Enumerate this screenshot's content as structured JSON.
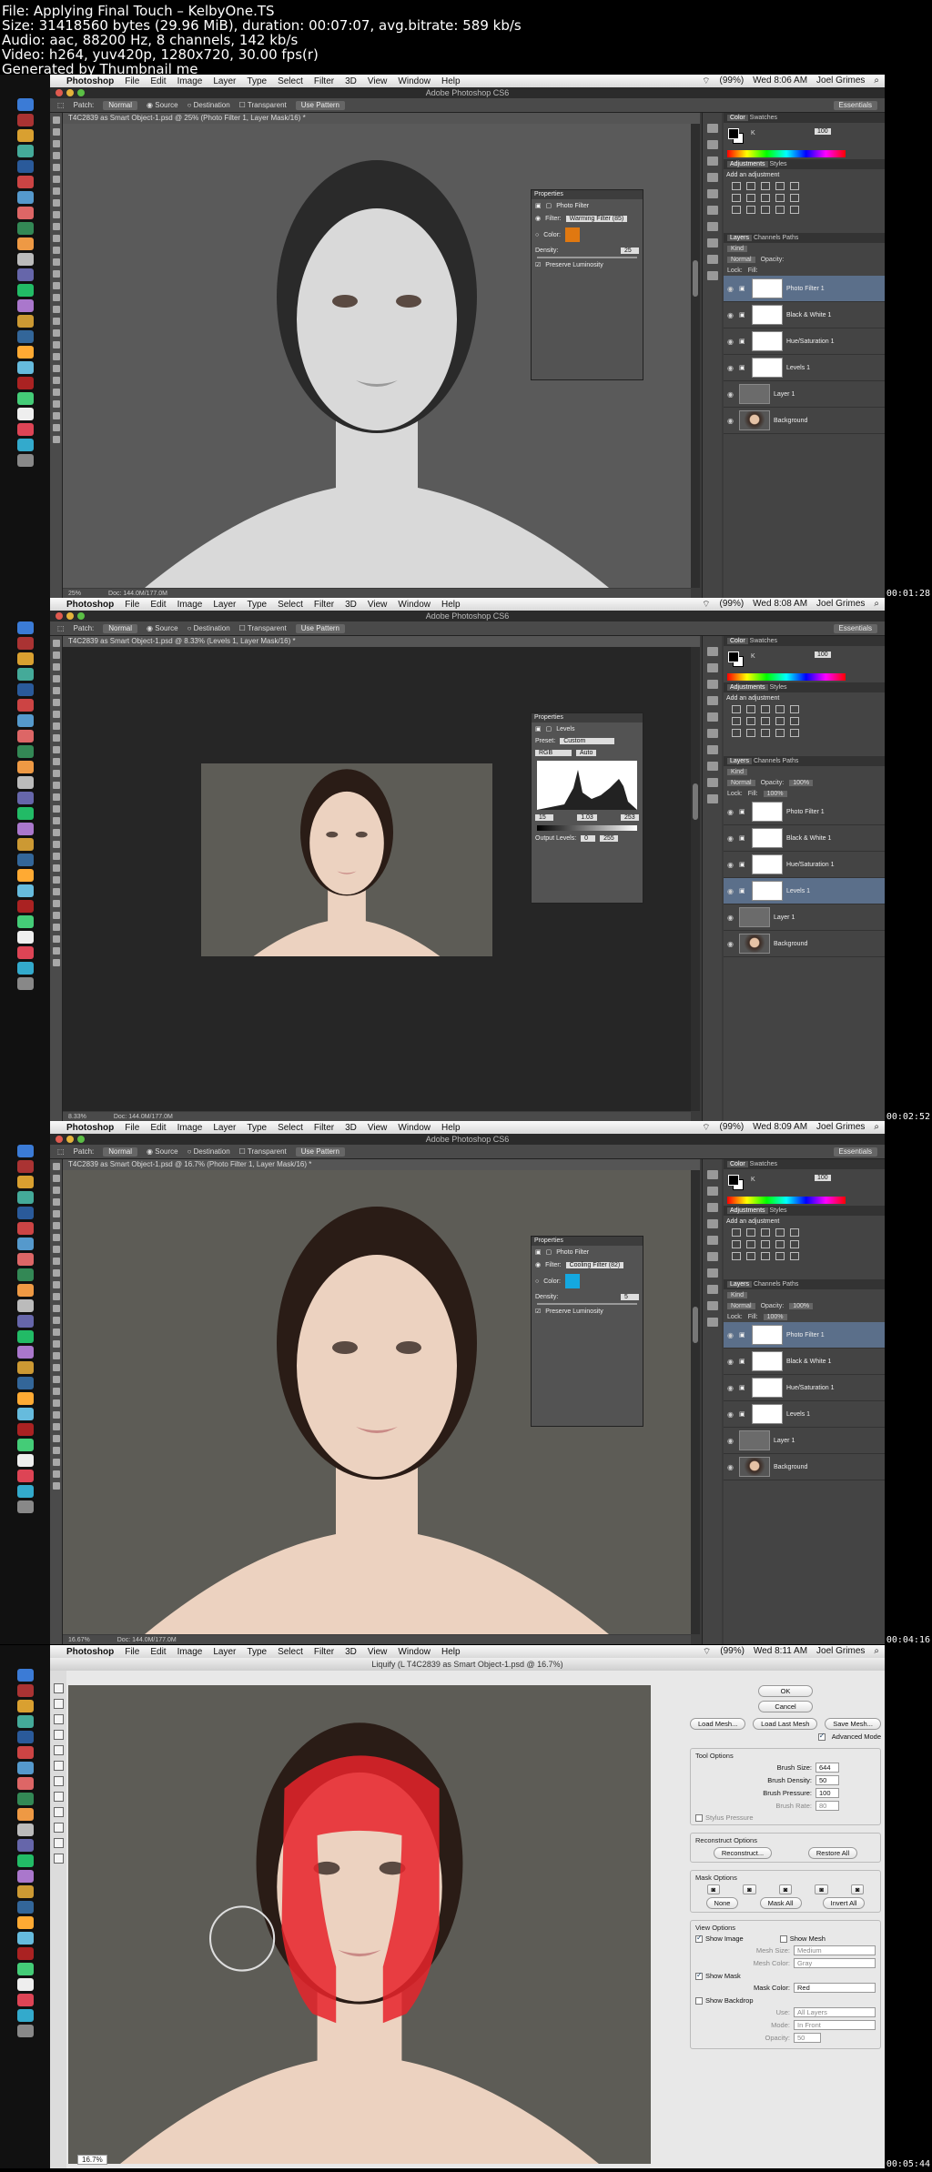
{
  "info": {
    "file": "File: Applying Final Touch – KelbyOne.TS",
    "size": "Size: 31418560 bytes (29.96 MiB), duration: 00:07:07, avg.bitrate: 589 kb/s",
    "audio": "Audio: aac, 88200 Hz, 8 channels, 142 kb/s",
    "video": "Video: h264, yuv420p, 1280x720, 30.00 fps(r)",
    "generated": "Generated by Thumbnail me"
  },
  "menu": {
    "app": "Photoshop",
    "items": [
      "File",
      "Edit",
      "Image",
      "Layer",
      "Type",
      "Select",
      "Filter",
      "3D",
      "View",
      "Window",
      "Help"
    ],
    "user": "Joel Grimes",
    "battery": "(99%)"
  },
  "colors": {
    "accent": "#5b6f8a",
    "orange_filter": "#e07810",
    "cyan_filter": "#14a8e0",
    "mask_red": "#e8232a"
  },
  "frames": [
    {
      "time": "Wed 8:06 AM",
      "timestamp": "00:01:28",
      "window_title": "Adobe Photoshop CS6",
      "doc_tab": "T4C2839 as Smart Object-1.psd @ 25% (Photo Filter 1, Layer Mask/16) *",
      "zoom": "25%",
      "doc_info": "Doc: 144.0M/177.0M",
      "props_title": "Properties",
      "props_type": "Photo Filter",
      "filter_label": "Filter:",
      "filter_value": "Warming Filter (85)",
      "color_label": "Color:",
      "density_label": "Density:",
      "density_value": "25",
      "preserve": "Preserve Luminosity",
      "k_value": "100",
      "layers": [
        "Photo Filter 1",
        "Black & White 1",
        "Hue/Saturation 1",
        "Levels 1",
        "Layer 1",
        "Background"
      ],
      "selected": 0
    },
    {
      "time": "Wed 8:08 AM",
      "timestamp": "00:02:52",
      "window_title": "Adobe Photoshop CS6",
      "doc_tab": "T4C2839 as Smart Object-1.psd @ 8.33% (Levels 1, Layer Mask/16) *",
      "zoom": "8.33%",
      "doc_info": "Doc: 144.0M/177.0M",
      "props_title": "Properties",
      "props_type": "Levels",
      "preset_label": "Preset:",
      "preset_value": "Custom",
      "channel": "RGB",
      "auto": "Auto",
      "input_levels": [
        "15",
        "1.03",
        "253"
      ],
      "output_label": "Output Levels:",
      "output_levels": [
        "0",
        "255"
      ],
      "k_value": "100",
      "opacity": "100%",
      "fill": "100%",
      "layers": [
        "Photo Filter 1",
        "Black & White 1",
        "Hue/Saturation 1",
        "Levels 1",
        "Layer 1",
        "Background"
      ],
      "selected": 3
    },
    {
      "time": "Wed 8:09 AM",
      "timestamp": "00:04:16",
      "window_title": "Adobe Photoshop CS6",
      "doc_tab": "T4C2839 as Smart Object-1.psd @ 16.7% (Photo Filter 1, Layer Mask/16) *",
      "zoom": "16.67%",
      "doc_info": "Doc: 144.0M/177.0M",
      "props_title": "Properties",
      "props_type": "Photo Filter",
      "filter_label": "Filter:",
      "filter_value": "Cooling Filter (82)",
      "color_label": "Color:",
      "density_label": "Density:",
      "density_value": "5",
      "preserve": "Preserve Luminosity",
      "k_value": "100",
      "opacity": "100%",
      "fill": "100%",
      "layers": [
        "Photo Filter 1",
        "Black & White 1",
        "Hue/Saturation 1",
        "Levels 1",
        "Layer 1",
        "Background"
      ],
      "selected": 0
    },
    {
      "time": "Wed 8:11 AM",
      "timestamp": "00:05:44",
      "window_title": "Liquify (L T4C2839 as Smart Object-1.psd @ 16.7%)",
      "zoom": "16.7%",
      "ok": "OK",
      "cancel": "Cancel",
      "load_mesh": "Load Mesh...",
      "load_last_mesh": "Load Last Mesh",
      "save_mesh": "Save Mesh...",
      "advanced_mode": "Advanced Mode",
      "tool_options": "Tool Options",
      "brush_size_label": "Brush Size:",
      "brush_size": "644",
      "brush_density_label": "Brush Density:",
      "brush_density": "50",
      "brush_pressure_label": "Brush Pressure:",
      "brush_pressure": "100",
      "brush_rate_label": "Brush Rate:",
      "brush_rate": "80",
      "stylus": "Stylus Pressure",
      "reconstruct_options": "Reconstruct Options",
      "reconstruct": "Reconstruct...",
      "restore_all": "Restore All",
      "mask_options": "Mask Options",
      "none": "None",
      "mask_all": "Mask All",
      "invert_all": "Invert All",
      "view_options": "View Options",
      "show_image": "Show Image",
      "show_mesh": "Show Mesh",
      "mesh_size_label": "Mesh Size:",
      "mesh_size": "Medium",
      "mesh_color_label": "Mesh Color:",
      "mesh_color": "Gray",
      "show_mask": "Show Mask",
      "mask_color_label": "Mask Color:",
      "mask_color": "Red",
      "show_backdrop": "Show Backdrop",
      "use_label": "Use:",
      "use_value": "All Layers",
      "mode_label": "Mode:",
      "mode_value": "In Front",
      "opacity_label": "Opacity:",
      "opacity_value": "50"
    }
  ]
}
